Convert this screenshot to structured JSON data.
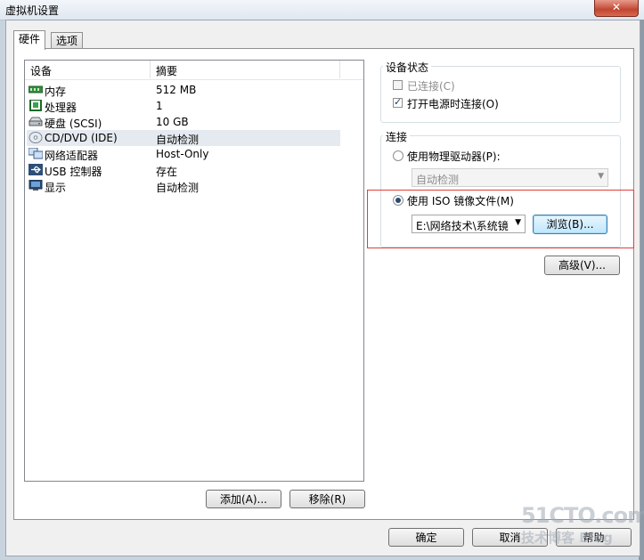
{
  "window": {
    "title": "虚拟机设置",
    "close_icon": "close-icon",
    "close_glyph": "✕"
  },
  "tabs": [
    {
      "label": "硬件",
      "active": true
    },
    {
      "label": "选项",
      "active": false
    }
  ],
  "device_list": {
    "columns": [
      "设备",
      "摘要"
    ],
    "rows": [
      {
        "icon": "memory-icon",
        "device": "内存",
        "summary": "512 MB",
        "selected": false
      },
      {
        "icon": "processor-icon",
        "device": "处理器",
        "summary": "1",
        "selected": false
      },
      {
        "icon": "hard-disk-icon",
        "device": "硬盘 (SCSI)",
        "summary": "10 GB",
        "selected": false
      },
      {
        "icon": "cd-dvd-icon",
        "device": "CD/DVD (IDE)",
        "summary": "自动检测",
        "selected": true
      },
      {
        "icon": "network-adapter-icon",
        "device": "网络适配器",
        "summary": "Host-Only",
        "selected": false
      },
      {
        "icon": "usb-icon",
        "device": "USB 控制器",
        "summary": "存在",
        "selected": false
      },
      {
        "icon": "display-icon",
        "device": "显示",
        "summary": "自动检测",
        "selected": false
      }
    ]
  },
  "buttons": {
    "add": "添加(A)...",
    "remove": "移除(R)",
    "browse": "浏览(B)...",
    "advanced": "高级(V)...",
    "ok": "确定",
    "cancel": "取消",
    "help": "帮助"
  },
  "device_status": {
    "label": "设备状态",
    "connected": {
      "label": "已连接(C)",
      "checked": false,
      "enabled": false
    },
    "connect_at_power_on": {
      "label": "打开电源时连接(O)",
      "checked": true,
      "enabled": true
    }
  },
  "connection": {
    "label": "连接",
    "physical_drive": {
      "label": "使用物理驱动器(P):",
      "selected": false,
      "value": "自动检测"
    },
    "iso_image": {
      "label": "使用 ISO 镜像文件(M)",
      "selected": true,
      "value": "E:\\网络技术\\系统镜"
    }
  },
  "watermark": {
    "brand": "51CTO.com",
    "tagline": "技术博客 Blog"
  },
  "colors": {
    "highlight_box": "#e03c3c",
    "selected_row": "#e5eaf0"
  }
}
